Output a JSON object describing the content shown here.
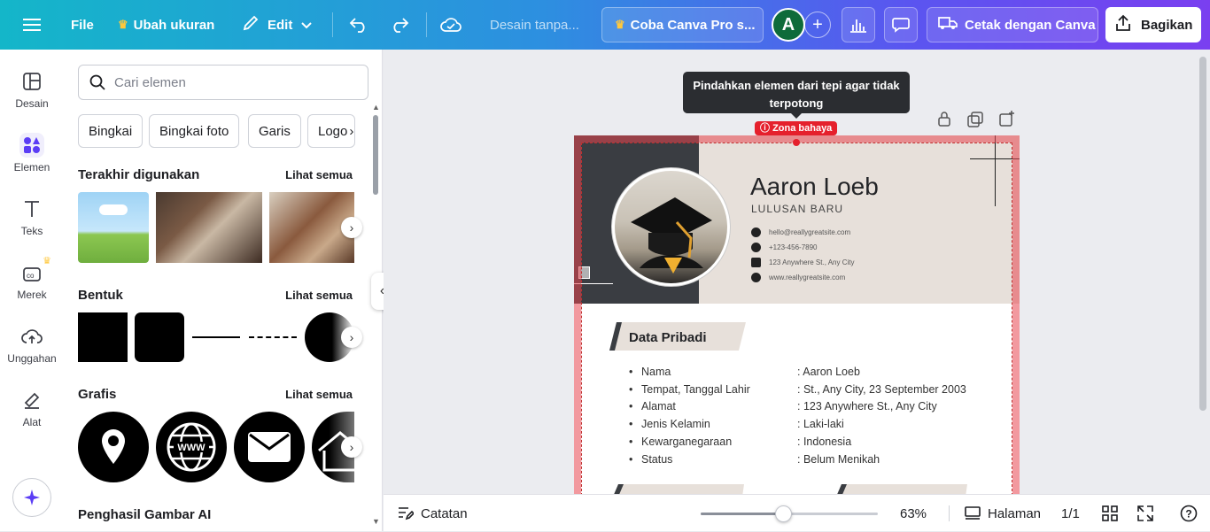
{
  "topbar": {
    "file_label": "File",
    "resize_label": "Ubah ukuran",
    "edit_label": "Edit",
    "design_title": "Desain tanpa...",
    "pro_label": "Coba Canva Pro s...",
    "avatar_letter": "A",
    "print_label": "Cetak dengan Canva",
    "share_label": "Bagikan"
  },
  "leftnav": {
    "items": [
      {
        "label": "Desain",
        "icon": "layout-icon"
      },
      {
        "label": "Elemen",
        "icon": "shapes-icon"
      },
      {
        "label": "Teks",
        "icon": "text-icon"
      },
      {
        "label": "Merek",
        "icon": "brand-icon"
      },
      {
        "label": "Unggahan",
        "icon": "upload-icon"
      },
      {
        "label": "Alat",
        "icon": "tools-icon"
      }
    ]
  },
  "panel": {
    "search_placeholder": "Cari elemen",
    "chips": [
      "Bingkai",
      "Bingkai foto",
      "Garis",
      "Logo"
    ],
    "recent_title": "Terakhir digunakan",
    "shapes_title": "Bentuk",
    "graphics_title": "Grafis",
    "ai_title": "Penghasil Gambar AI",
    "see_all": "Lihat semua"
  },
  "canvas": {
    "tooltip": "Pindahkan elemen dari tepi agar tidak terpotong",
    "danger_label": "Zona bahaya",
    "resume": {
      "name": "Aaron Loeb",
      "role": "LULUSAN BARU",
      "contacts": [
        "hello@reallygreatsite.com",
        "+123-456-7890",
        "123 Anywhere St., Any City",
        "www.reallygreatsite.com"
      ],
      "section_title": "Data Pribadi",
      "rows": [
        {
          "key": "Nama",
          "value": ": Aaron Loeb"
        },
        {
          "key": "Tempat, Tanggal Lahir",
          "value": ": St., Any City, 23 September 2003"
        },
        {
          "key": "Alamat",
          "value": ": 123 Anywhere St., Any City"
        },
        {
          "key": "Jenis Kelamin",
          "value": ": Laki-laki"
        },
        {
          "key": "Kewarganegaraan",
          "value": ": Indonesia"
        },
        {
          "key": "Status",
          "value": ": Belum Menikah"
        }
      ]
    }
  },
  "bottombar": {
    "notes_label": "Catatan",
    "zoom_value": "63%",
    "zoom_fraction": 0.47,
    "pages_label": "Halaman",
    "page_count": "1/1"
  },
  "colors": {
    "accent": "#8b3dff",
    "danger": "#e5202c",
    "header_beige": "#e7e0da",
    "header_dark": "#3a3d42"
  }
}
